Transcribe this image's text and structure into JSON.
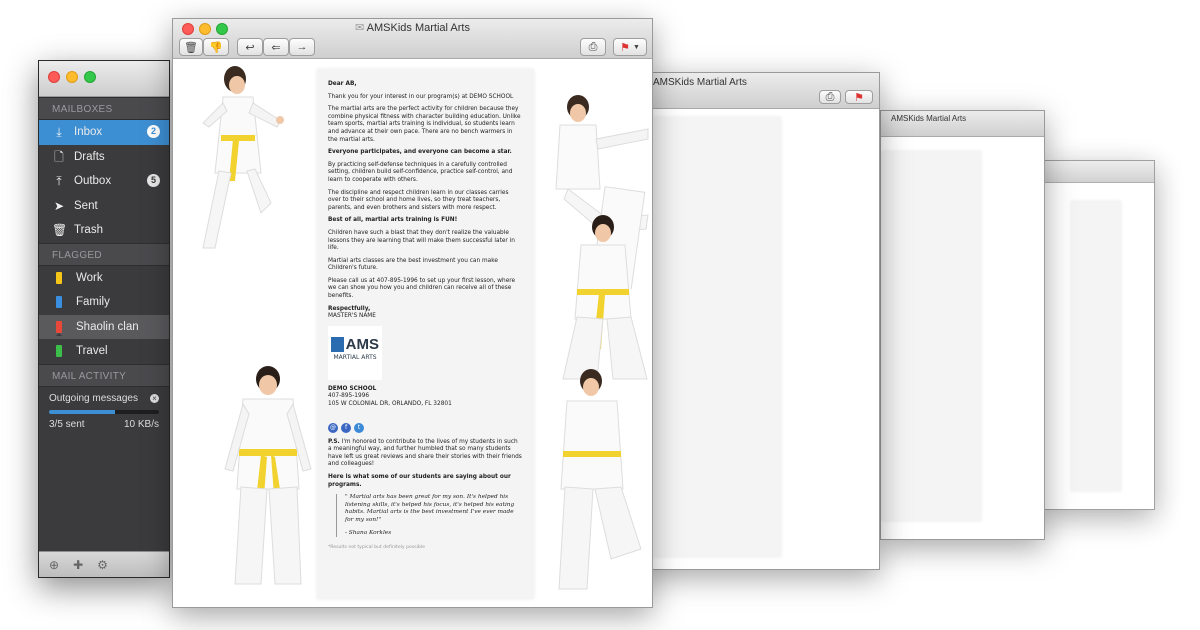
{
  "window_title": "AMSKids Martial Arts",
  "sidebar": {
    "sections": {
      "mailboxes": "MAILBOXES",
      "flagged": "FLAGGED",
      "mail_activity": "MAIL ACTIVITY"
    },
    "mailboxes": [
      {
        "label": "Inbox",
        "icon": "inbox-icon",
        "badge": "2",
        "selected": true
      },
      {
        "label": "Drafts",
        "icon": "document-icon"
      },
      {
        "label": "Outbox",
        "icon": "outbox-icon",
        "badge": "5"
      },
      {
        "label": "Sent",
        "icon": "paper-plane-icon"
      },
      {
        "label": "Trash",
        "icon": "trash-icon"
      }
    ],
    "flagged": [
      {
        "label": "Work",
        "color": "#f5c518"
      },
      {
        "label": "Family",
        "color": "#3b8fe0"
      },
      {
        "label": "Shaolin clan",
        "color": "#e8483a",
        "highlighted": true
      },
      {
        "label": "Travel",
        "color": "#3cbf4a"
      }
    ],
    "activity": {
      "label": "Outgoing messages",
      "progress_text": "3/5 sent",
      "progress_fraction": 0.6,
      "speed": "10 KB/s"
    }
  },
  "email": {
    "greeting": "Dear AB,",
    "intro": "Thank you for your interest in our program(s) at DEMO SCHOOL",
    "p1": "The martial arts are the perfect activity for children because they combine physical fitness with character building education. Unlike team sports, martial arts training is individual, so students learn and advance at their own pace. There are no bench warmers in the martial arts.",
    "h1": "Everyone participates, and everyone can become a star.",
    "p2": "By practicing self-defense techniques in a carefully controlled setting, children build self-confidence, practice self-control, and learn to cooperate with others.",
    "p3": "The discipline and respect children learn in our classes carries over to their school and home lives, so they treat teachers, parents, and even brothers and sisters with more respect.",
    "h2": "Best of all, martial arts training is FUN!",
    "p4": "Children have such a blast that they don't realize the valuable lessons they are learning that will make them successful later in life.",
    "p5": "Martial arts classes are the best investment you can make Children's future.",
    "p6": "Please call us at 407-895-1996 to set up your first lesson, where we can show you how you and children can receive all of these benefits.",
    "signoff": "Respectfully,",
    "signer": "MASTER'S NAME",
    "logo_big": "AMS",
    "logo_small": "MARTIAL ARTS",
    "school": "DEMO SCHOOL",
    "phone": "407-895-1996",
    "address": "105 W COLONIAL DR, ORLANDO, FL 32801",
    "ps_label": "P.S.",
    "ps": "I'm honored to contribute to the lives of my students in such a meaningful way, and further humbled that so many students have left us great reviews and share their stories with their friends and colleagues!",
    "h3": "Here is what some of our students are saying about our programs.",
    "quote": "\" Martial arts has been great for my son. It's helped his listening skills, it's helped his focus, it's helped his eating habits. Martial arts is the best investment I've ever made for my son!\"",
    "quote_author": "- Shana Korkles",
    "disclaimer": "*Results not typical but definitely possible",
    "social": [
      "mail-icon",
      "facebook-icon",
      "twitter-icon"
    ]
  },
  "toolbar": {
    "delete": "trash-icon",
    "junk": "thumbs-down-icon",
    "reply": "reply-icon",
    "reply_all": "reply-all-icon",
    "forward": "forward-icon",
    "print": "printer-icon",
    "flag": "flag-icon"
  }
}
